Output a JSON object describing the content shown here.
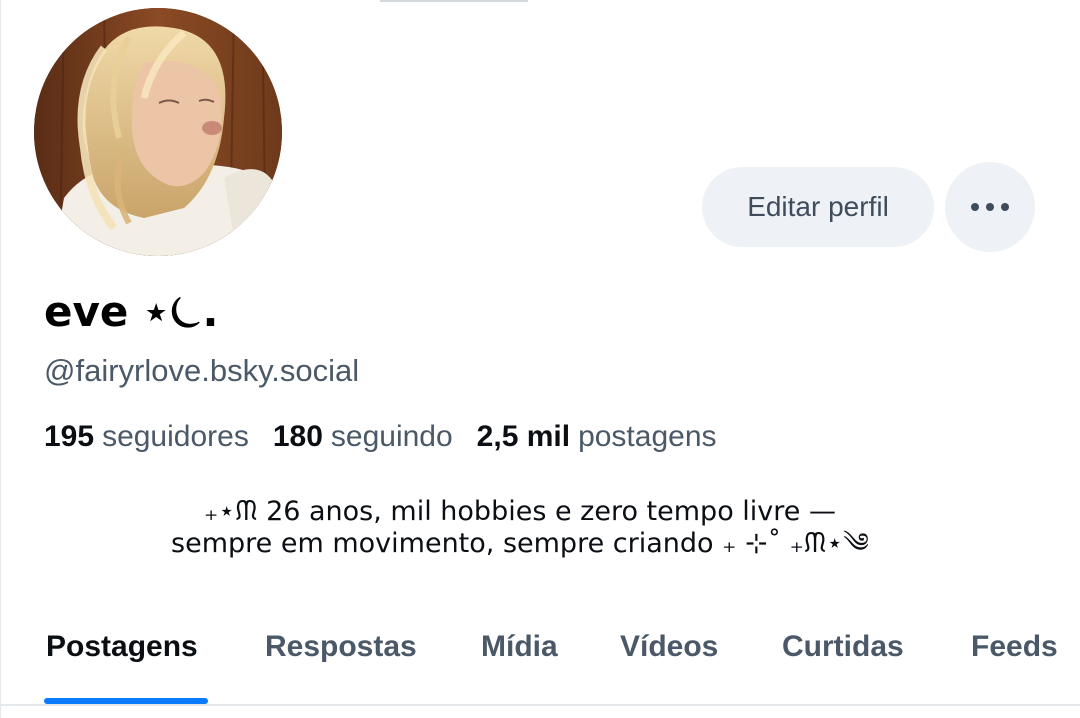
{
  "profile": {
    "display_name": "eve ⋆⏾.",
    "display_name_text": "eve",
    "handle": "@fairyrlove.bsky.social",
    "bio": "₊⋆ᙏ 26 anos, mil hobbies e zero tempo livre —\nsempre em movimento, sempre criando ₊ ⊹˚ ₊ᙏ⋆༄"
  },
  "actions": {
    "edit_label": "Editar perfil",
    "more_icon": "ellipsis-icon"
  },
  "stats": [
    {
      "value": "195",
      "label": "seguidores"
    },
    {
      "value": "180",
      "label": "seguindo"
    },
    {
      "value": "2,5 mil",
      "label": "postagens"
    }
  ],
  "tabs": [
    {
      "label": "Postagens",
      "active": true
    },
    {
      "label": "Respostas",
      "active": false
    },
    {
      "label": "Mídia",
      "active": false
    },
    {
      "label": "Vídeos",
      "active": false
    },
    {
      "label": "Curtidas",
      "active": false
    },
    {
      "label": "Feeds",
      "active": false
    }
  ],
  "colors": {
    "accent": "#0a7aff",
    "button_bg": "#eef1f5",
    "muted_text": "#4a5868",
    "primary_text": "#0b0f14"
  }
}
